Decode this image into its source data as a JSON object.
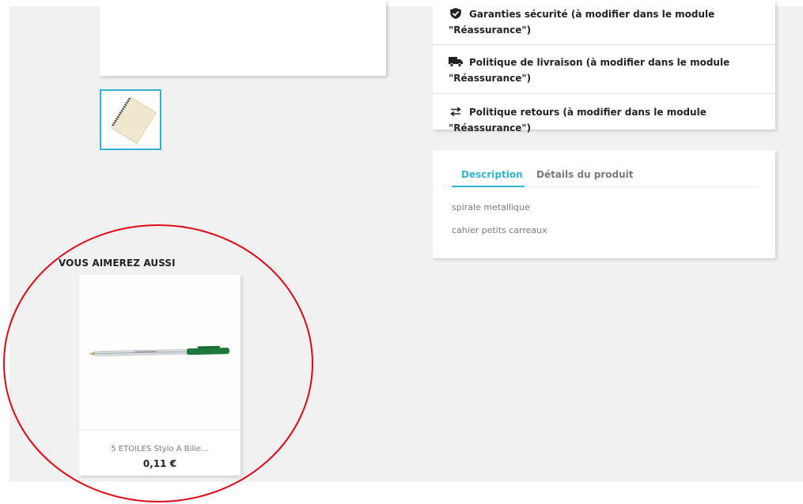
{
  "reassurance": {
    "items": [
      {
        "icon": "shield-check-icon",
        "line1": "Garanties sécurité (à modifier dans le module",
        "line2": "\"Réassurance\")"
      },
      {
        "icon": "truck-icon",
        "line1": "Politique de livraison (à modifier dans le module",
        "line2": "\"Réassurance\")"
      },
      {
        "icon": "exchange-arrows-icon",
        "line1": "Politique retours (à modifier dans le module \"Réassurance\")",
        "line2": ""
      }
    ]
  },
  "product_tabs": {
    "tabs": [
      {
        "label": "Description",
        "active": true
      },
      {
        "label": "Détails du produit",
        "active": false
      }
    ],
    "description_lines": [
      "spirale metallique",
      "cahier petits carreaux"
    ]
  },
  "related": {
    "title": "VOUS AIMEREZ AUSSI",
    "products": [
      {
        "name": "5 ETOILES Stylo À Bille...",
        "price": "0,11 €"
      }
    ]
  },
  "colors": {
    "accent": "#2fb5d2",
    "annotation": "#e30613",
    "background": "#f1f1f1"
  }
}
